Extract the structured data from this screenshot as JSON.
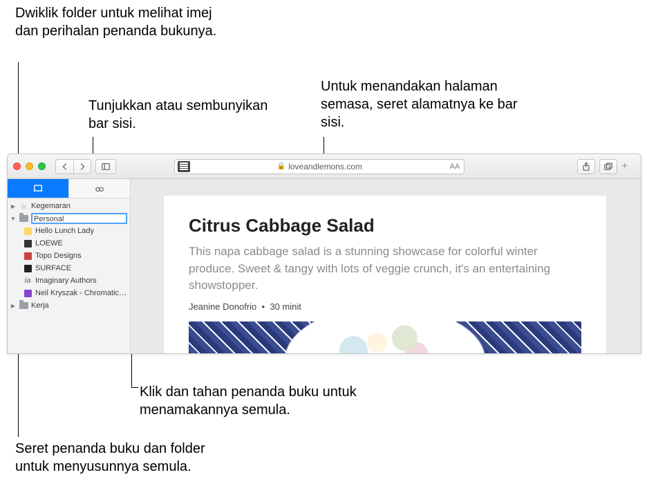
{
  "callouts": {
    "c1": "Dwiklik folder untuk melihat imej dan perihalan penanda bukunya.",
    "c2": "Tunjukkan atau sembunyikan bar sisi.",
    "c3": "Untuk menandakan halaman semasa, seret alamatnya ke bar sisi.",
    "c4": "Klik dan tahan penanda buku untuk menamakannya semula.",
    "c5": "Seret penanda buku dan folder untuk menyusunnya semula."
  },
  "toolbar": {
    "url_host": "loveandlemons.com",
    "text_size_label": "AA"
  },
  "sidebar": {
    "folders": {
      "favorites": "Kegemaran",
      "personal": "Personal",
      "work": "Kerja"
    },
    "bookmarks": [
      "Hello Lunch Lady",
      "LOEWE",
      "Topo Designs",
      "SURFACE",
      "Imaginary Authors",
      "Neil Kryszak - Chromatic E…"
    ]
  },
  "article": {
    "title": "Citrus Cabbage Salad",
    "description": "This napa cabbage salad is a stunning showcase for colorful winter produce. Sweet & tangy with lots of veggie crunch, it's an entertaining showstopper.",
    "author": "Jeanine Donofrio",
    "meta_sep": "•",
    "duration": "30 minit"
  }
}
